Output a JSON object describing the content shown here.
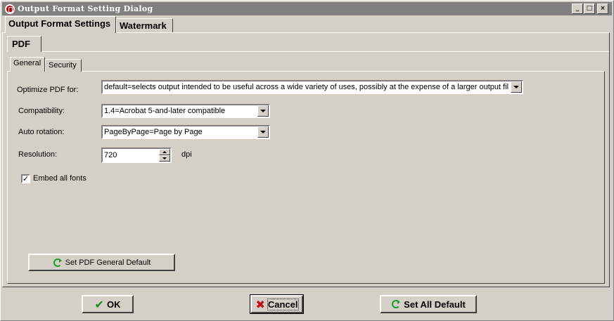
{
  "window": {
    "title": "Output Format Setting Dialog",
    "controls": {
      "minimize": "_",
      "maximize": "□",
      "close": "×"
    }
  },
  "tabs": [
    {
      "label": "Output Format Settings",
      "selected": true
    },
    {
      "label": "Watermark",
      "selected": false
    }
  ],
  "format_tabs": [
    {
      "label": "PDF",
      "selected": true
    }
  ],
  "sub_tabs": [
    {
      "label": "General",
      "selected": true
    },
    {
      "label": "Security",
      "selected": false
    }
  ],
  "general": {
    "optimize_label": "Optimize PDF for:",
    "optimize_value": "default=selects output intended to be useful across a wide variety of uses, possibly at the expense of a larger output fil",
    "compat_label": "Compatibility:",
    "compat_value": "1.4=Acrobat 5-and-later compatible",
    "rotation_label": "Auto rotation:",
    "rotation_value": "PageByPage=Page by Page",
    "resolution_label": "Resolution:",
    "resolution_value": "720",
    "resolution_unit": "dpi",
    "embed_label": "Embed all fonts",
    "embed_checked": true,
    "embed_mark": "✓",
    "set_default_label": "Set PDF General Default"
  },
  "footer": {
    "ok_label": "OK",
    "cancel_label": "Cancel",
    "set_all_label": "Set All Default"
  },
  "icons": {
    "ok": "check-icon",
    "cancel": "x-icon",
    "reset": "refresh-icon"
  },
  "colors": {
    "face": "#d4d0c8",
    "titlebar": "#808080",
    "accent_green": "#1a9c2e",
    "accent_red": "#c01010"
  }
}
